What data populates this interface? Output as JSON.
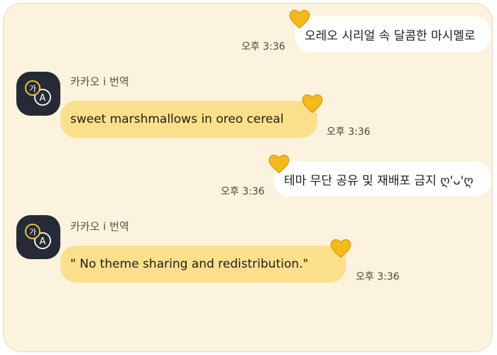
{
  "messages": [
    {
      "text": "오레오 시리얼 속 달콤한 마시멜로",
      "time": "오후 3:36"
    },
    {
      "sender": "카카오 i 번역",
      "text": "sweet marshmallows in oreo cereal",
      "time": "오후 3:36"
    },
    {
      "text": "테마 무단 공유 및 재배포 금지 ღ'ᴗ'ღ",
      "time": "오후 3:36"
    },
    {
      "sender": "카카오 i 번역",
      "text": "\" No theme sharing and redistribution.\"",
      "time": "오후 3:36"
    }
  ],
  "avatar": {
    "glyph_main": "가",
    "glyph_sub": "A"
  },
  "colors": {
    "background": "#fbf3dd",
    "my_bubble": "#ffffff",
    "bot_bubble": "#fbe08b",
    "heart": "#f7b81a",
    "avatar_bg": "#262a36"
  },
  "icons": [
    "yellow-heart-icon",
    "translate-avatar-icon"
  ]
}
